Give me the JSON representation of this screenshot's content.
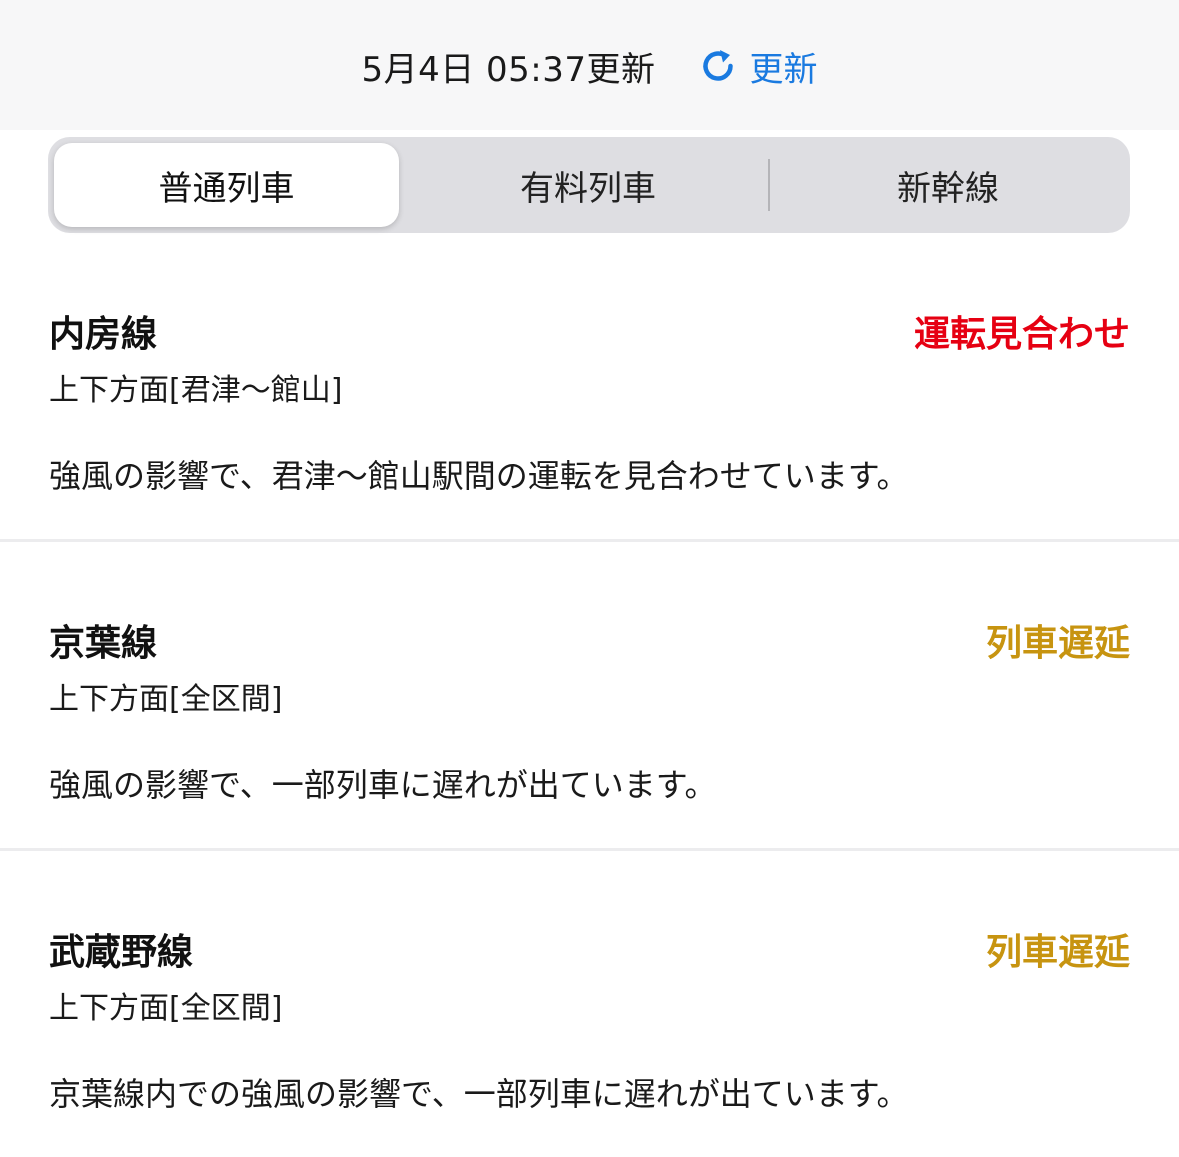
{
  "header": {
    "update_time": "5月4日 05:37更新",
    "refresh_label": "更新",
    "refresh_icon": "refresh-icon"
  },
  "colors": {
    "accent": "#1a7ae0",
    "status_suspended": "#e60012",
    "status_delay": "#c79410"
  },
  "tabs": [
    {
      "label": "普通列車",
      "active": true
    },
    {
      "label": "有料列車",
      "active": false
    },
    {
      "label": "新幹線",
      "active": false
    }
  ],
  "lines": [
    {
      "name": "内房線",
      "status": "運転見合わせ",
      "status_color": "#e60012",
      "direction": "上下方面[君津〜館山]",
      "message": "強風の影響で、君津〜館山駅間の運転を見合わせています。"
    },
    {
      "name": "京葉線",
      "status": "列車遅延",
      "status_color": "#c79410",
      "direction": "上下方面[全区間]",
      "message": "強風の影響で、一部列車に遅れが出ています。"
    },
    {
      "name": "武蔵野線",
      "status": "列車遅延",
      "status_color": "#c79410",
      "direction": "上下方面[全区間]",
      "message": "京葉線内での強風の影響で、一部列車に遅れが出ています。"
    }
  ]
}
